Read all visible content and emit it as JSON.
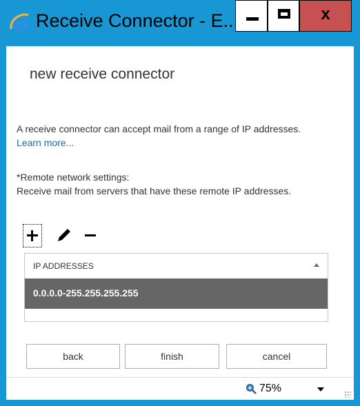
{
  "window": {
    "title": "Receive Connector - E..."
  },
  "controls": {
    "minimize": "minimize",
    "maximize": "maximize",
    "close": "x"
  },
  "page": {
    "heading": "new receive connector",
    "intro_text": "A receive connector can accept mail from a range of IP addresses.",
    "learn_more": "Learn more...",
    "remote_label": "*Remote network settings:",
    "remote_desc": "Receive mail from servers that have these remote IP addresses."
  },
  "table": {
    "column_header": "IP ADDRESSES",
    "rows": [
      "0.0.0.0-255.255.255.255"
    ]
  },
  "buttons": {
    "back": "back",
    "finish": "finish",
    "cancel": "cancel"
  },
  "status": {
    "zoom": "75%"
  },
  "icons": {
    "app": "internet-explorer-icon",
    "add": "plus-icon",
    "edit": "pencil-icon",
    "remove": "minus-icon",
    "zoom": "magnifier-icon"
  },
  "colors": {
    "frame": "#1797d4",
    "close": "#c75050",
    "link": "#0072c6",
    "selected_row": "#666666"
  }
}
